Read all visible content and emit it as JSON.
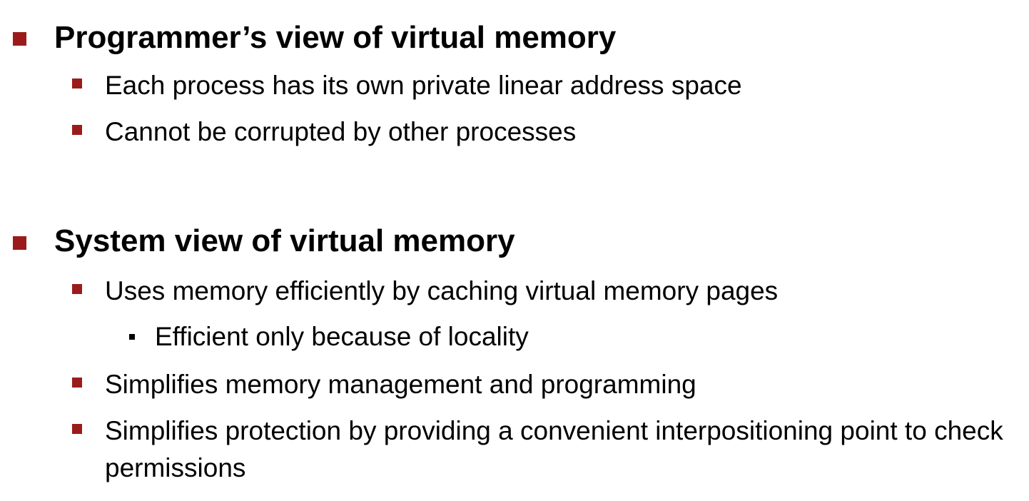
{
  "bullet_color": "#9b1b1b",
  "sections": [
    {
      "title": "Programmer’s view of virtual memory",
      "items": [
        "Each process has its own private linear address space",
        "Cannot be corrupted by other processes"
      ]
    },
    {
      "title": "System view of virtual memory",
      "items": [
        "Uses memory efficiently by caching virtual memory pages",
        "Simplifies memory management and programming",
        "Simplifies protection by providing a convenient interpositioning point to check permissions"
      ],
      "subitems": [
        "Efficient only because of locality"
      ]
    }
  ]
}
